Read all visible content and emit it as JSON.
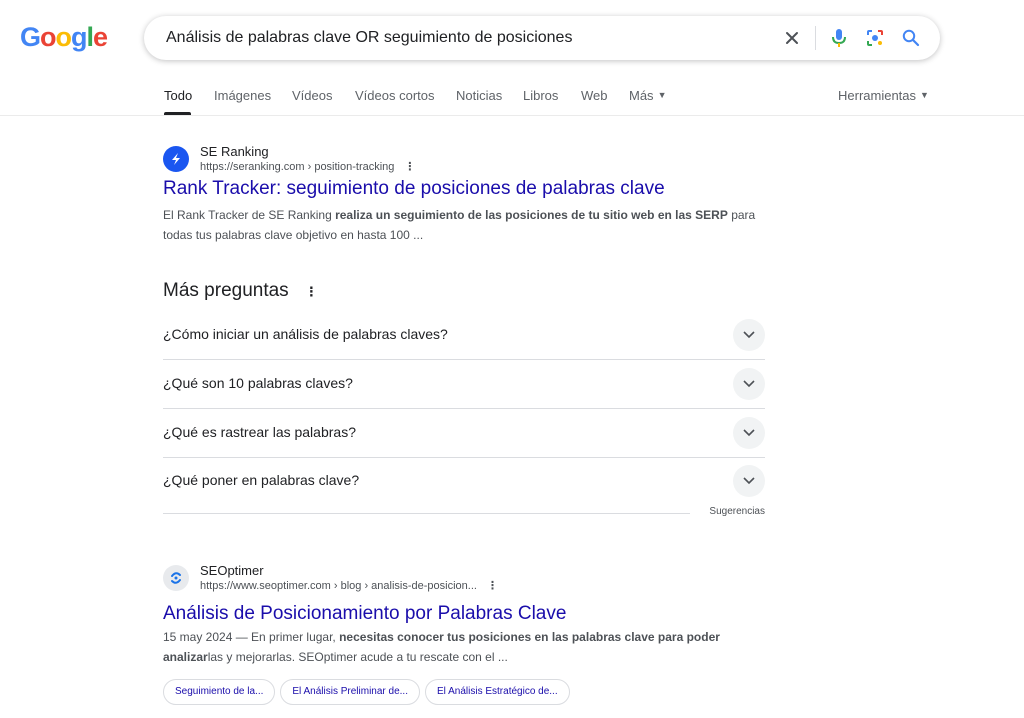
{
  "logo": {
    "letters": [
      "G",
      "o",
      "o",
      "g",
      "l",
      "e"
    ],
    "colors": [
      "#4285f4",
      "#ea4335",
      "#fbbc05",
      "#4285f4",
      "#34a853",
      "#ea4335"
    ]
  },
  "search": {
    "query": "Análisis de palabras clave OR seguimiento de posiciones"
  },
  "tabs": {
    "all": "Todo",
    "images": "Imágenes",
    "videos": "Vídeos",
    "short_videos": "Vídeos cortos",
    "news": "Noticias",
    "books": "Libros",
    "web": "Web",
    "more": "Más",
    "tools": "Herramientas"
  },
  "results": [
    {
      "site": "SE Ranking",
      "url": "https://seranking.com › position-tracking",
      "title": "Rank Tracker: seguimiento de posiciones de palabras clave",
      "snippet_parts": [
        "El Rank Tracker de SE Ranking ",
        "realiza un seguimiento de las posiciones de tu sitio web en las SERP",
        " para todas tus palabras clave objetivo en hasta 100 ..."
      ]
    },
    {
      "site": "SEOptimer",
      "url": "https://www.seoptimer.com › blog › analisis-de-posicion...",
      "title": "Análisis de Posicionamiento por Palabras Clave",
      "snippet_parts": [
        "15 may 2024 — En primer lugar, ",
        "necesitas conocer tus posiciones en las palabras clave para poder analizar",
        "las y mejorarlas. SEOptimer acude a tu rescate con el ..."
      ],
      "chips": [
        "Seguimiento de la...",
        "El Análisis Preliminar de...",
        "El Análisis Estratégico de..."
      ]
    }
  ],
  "paa": {
    "title": "Más preguntas",
    "questions": [
      "¿Cómo iniciar un análisis de palabras claves?",
      "¿Qué son 10 palabras claves?",
      "¿Qué es rastrear las palabras?",
      "¿Qué poner en palabras clave?"
    ],
    "footer": "Sugerencias"
  },
  "colors": {
    "link": "#1a0dab",
    "text": "#202124",
    "muted": "#4d5156"
  }
}
